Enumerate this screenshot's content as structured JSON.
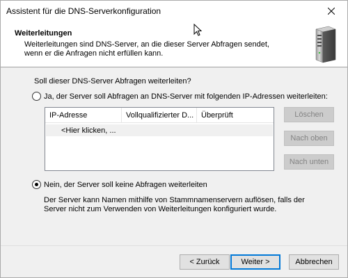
{
  "window": {
    "title": "Assistent für die DNS-Serverkonfiguration"
  },
  "header": {
    "title": "Weiterleitungen",
    "subtitle": "Weiterleitungen sind DNS-Server, an die dieser Server Abfragen sendet, wenn er die Anfragen nicht erfüllen kann.",
    "icon": "server-icon"
  },
  "question": "Soll dieser DNS-Server Abfragen weiterleiten?",
  "options": {
    "yes": {
      "label": "Ja, der Server soll Abfragen an DNS-Server mit folgenden IP-Adressen weiterleiten:",
      "selected": false
    },
    "no": {
      "label": "Nein, der Server soll keine Abfragen weiterleiten",
      "selected": true
    }
  },
  "table": {
    "columns": [
      "IP-Adresse",
      "Vollqualifizierter D...",
      "Überprüft"
    ],
    "placeholder_row": "<Hier klicken, ..."
  },
  "side_buttons": {
    "delete": "Löschen",
    "move_up": "Nach oben",
    "move_down": "Nach unten"
  },
  "description": "Der Server kann Namen mithilfe von Stammnamenservern auflösen, falls der Server nicht zum Verwenden von Weiterleitungen konfiguriert wurde.",
  "footer": {
    "back": "< Zurück",
    "next": "Weiter >",
    "cancel": "Abbrechen"
  },
  "colors": {
    "accent": "#0078d7",
    "disabled_text": "#838383"
  }
}
